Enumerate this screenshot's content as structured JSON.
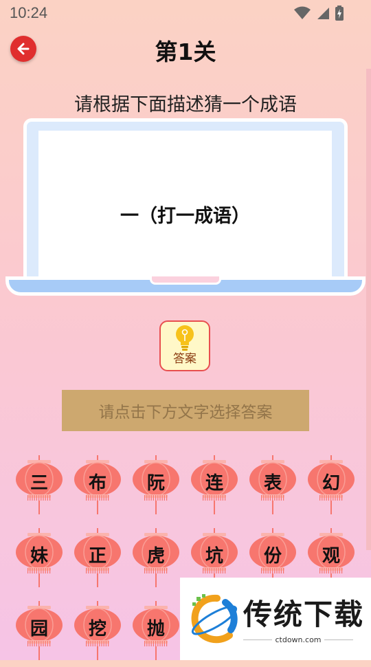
{
  "status_bar": {
    "time": "10:24",
    "icons": [
      "wifi-icon",
      "signal-icon",
      "battery-icon"
    ]
  },
  "header": {
    "title": "第1关",
    "back_icon": "arrow-left-icon"
  },
  "instruction": "请根据下面描述猜一个成语",
  "riddle": "一（打一成语）",
  "hint": {
    "label": "答案",
    "icon": "lightbulb-icon"
  },
  "answer_placeholder": "请点击下方文字选择答案",
  "characters": [
    [
      "三",
      "布",
      "阮",
      "连",
      "表",
      "幻"
    ],
    [
      "妹",
      "正",
      "虎",
      "坑",
      "份",
      "观"
    ],
    [
      "园",
      "挖",
      "抛"
    ]
  ],
  "watermark": {
    "name": "传统下载",
    "url": "ctdown.com"
  },
  "colors": {
    "back_button": "#e02e2e",
    "lantern": "#f7766e",
    "answer_box": "#cda86f",
    "laptop_screen_frame": "#dceafc",
    "laptop_base": "#a7cbf7"
  }
}
